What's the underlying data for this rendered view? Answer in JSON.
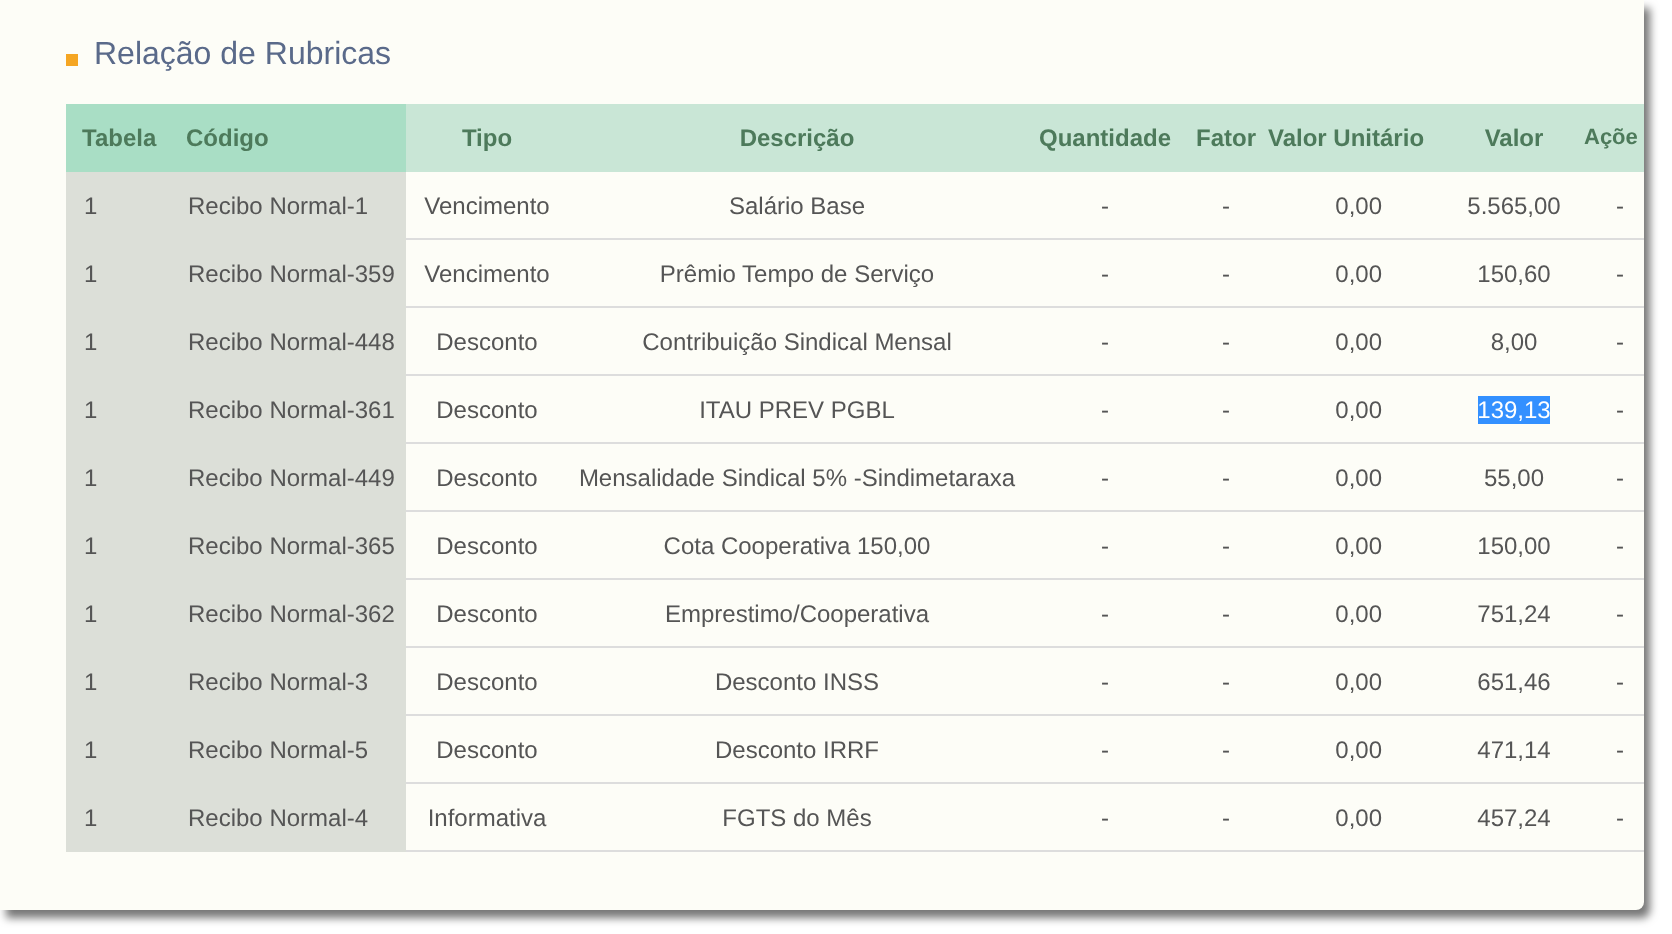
{
  "title": "Relação de Rubricas",
  "table": {
    "columns": [
      "Tabela",
      "Código",
      "Tipo",
      "Descrição",
      "Quantidade",
      "Fator",
      "Valor Unitário",
      "Valor",
      "Açõe"
    ],
    "rows": [
      {
        "tabela": "1",
        "codigo": "Recibo Normal-1",
        "tipo": "Vencimento",
        "descricao": "Salário Base",
        "quantidade": "-",
        "fator": "-",
        "valor_unitario": "0,00",
        "valor": "5.565,00",
        "valor_selected": false,
        "acoes": "-"
      },
      {
        "tabela": "1",
        "codigo": "Recibo Normal-359",
        "tipo": "Vencimento",
        "descricao": "Prêmio Tempo de Serviço",
        "quantidade": "-",
        "fator": "-",
        "valor_unitario": "0,00",
        "valor": "150,60",
        "valor_selected": false,
        "acoes": "-"
      },
      {
        "tabela": "1",
        "codigo": "Recibo Normal-448",
        "tipo": "Desconto",
        "descricao": "Contribuição Sindical Mensal",
        "quantidade": "-",
        "fator": "-",
        "valor_unitario": "0,00",
        "valor": "8,00",
        "valor_selected": false,
        "acoes": "-"
      },
      {
        "tabela": "1",
        "codigo": "Recibo Normal-361",
        "tipo": "Desconto",
        "descricao": "ITAU PREV PGBL",
        "quantidade": "-",
        "fator": "-",
        "valor_unitario": "0,00",
        "valor": "139,13",
        "valor_selected": true,
        "acoes": "-"
      },
      {
        "tabela": "1",
        "codigo": "Recibo Normal-449",
        "tipo": "Desconto",
        "descricao": "Mensalidade Sindical 5% -Sindimetaraxa",
        "quantidade": "-",
        "fator": "-",
        "valor_unitario": "0,00",
        "valor": "55,00",
        "valor_selected": false,
        "acoes": "-"
      },
      {
        "tabela": "1",
        "codigo": "Recibo Normal-365",
        "tipo": "Desconto",
        "descricao": "Cota Cooperativa 150,00",
        "quantidade": "-",
        "fator": "-",
        "valor_unitario": "0,00",
        "valor": "150,00",
        "valor_selected": false,
        "acoes": "-"
      },
      {
        "tabela": "1",
        "codigo": "Recibo Normal-362",
        "tipo": "Desconto",
        "descricao": "Emprestimo/Cooperativa",
        "quantidade": "-",
        "fator": "-",
        "valor_unitario": "0,00",
        "valor": "751,24",
        "valor_selected": false,
        "acoes": "-"
      },
      {
        "tabela": "1",
        "codigo": "Recibo Normal-3",
        "tipo": "Desconto",
        "descricao": "Desconto INSS",
        "quantidade": "-",
        "fator": "-",
        "valor_unitario": "0,00",
        "valor": "651,46",
        "valor_selected": false,
        "acoes": "-"
      },
      {
        "tabela": "1",
        "codigo": "Recibo Normal-5",
        "tipo": "Desconto",
        "descricao": "Desconto IRRF",
        "quantidade": "-",
        "fator": "-",
        "valor_unitario": "0,00",
        "valor": "471,14",
        "valor_selected": false,
        "acoes": "-"
      },
      {
        "tabela": "1",
        "codigo": "Recibo Normal-4",
        "tipo": "Informativa",
        "descricao": "FGTS do Mês",
        "quantidade": "-",
        "fator": "-",
        "valor_unitario": "0,00",
        "valor": "457,24",
        "valor_selected": false,
        "acoes": "-"
      }
    ]
  }
}
